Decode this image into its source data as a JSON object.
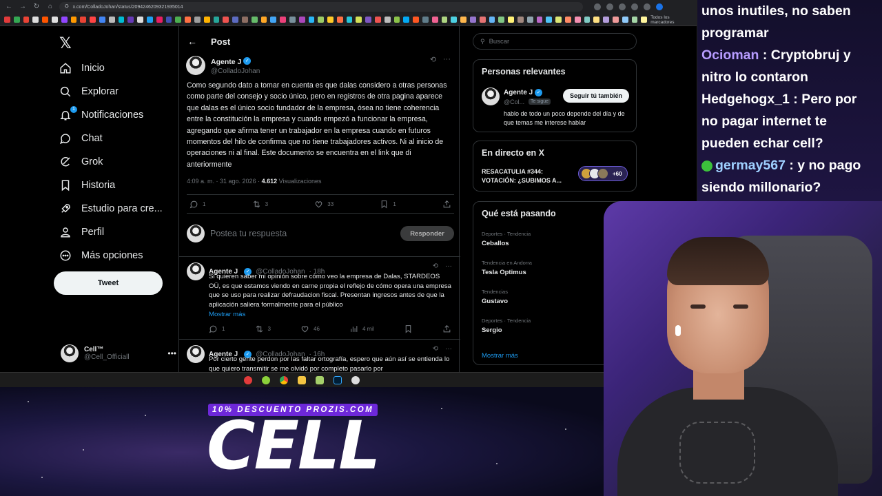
{
  "browser": {
    "url": "x.com/ColladoJohan/status/2094246209321935014",
    "bookmarks_label": "Todos los marcadores"
  },
  "nav": {
    "items": [
      {
        "label": "Inicio",
        "icon": "home-icon"
      },
      {
        "label": "Explorar",
        "icon": "search-icon"
      },
      {
        "label": "Notificaciones",
        "icon": "bell-icon"
      },
      {
        "label": "Chat",
        "icon": "chat-icon"
      },
      {
        "label": "Grok",
        "icon": "grok-icon"
      },
      {
        "label": "Historia",
        "icon": "bookmark-icon"
      },
      {
        "label": "Estudio para cre...",
        "icon": "rocket-icon"
      },
      {
        "label": "Perfil",
        "icon": "person-icon"
      },
      {
        "label": "Más opciones",
        "icon": "more-icon"
      }
    ],
    "notif_count": "1",
    "tweet_button": "Tweet",
    "account_name": "Cell™",
    "account_handle": "@Cell_Officiall"
  },
  "post": {
    "title": "Post",
    "author_name": "Agente J",
    "author_handle": "@ColladoJohan",
    "text": "Como segundo dato a tomar en cuenta es que dalas considero a otras personas como parte del consejo y socio único, pero en registros de otra pagina aparece que dalas es el único socio fundador de la empresa, ósea no tiene coherencia entre la constitución la empresa y cuando empezó a funcionar la empresa, agregando que afirma tener un trabajador en la empresa cuando en futuros momentos del hilo de confirma que no tiene trabajadores activos. Ni al inicio de operaciones ni al final. Este documento se encuentra en el link que di anteriormente",
    "time": "4:09 a. m. · 31 ago. 2026 ·",
    "views_count": "4.612",
    "views_label": "Visualizaciones",
    "replies": "1",
    "reposts": "3",
    "likes": "33",
    "bookmarks": "1",
    "reply_placeholder": "Postea tu respuesta",
    "reply_button": "Responder"
  },
  "replies": [
    {
      "name": "Agente J",
      "handle": "@ColladoJohan",
      "time": "· 18h",
      "text": "Si quieren saber mi opinión sobre cómo veo la empresa de Dalas, STARDEOS OÜ, es que estamos viendo en carne propia el reflejo de cómo opera una empresa que se uso para realizar defraudacion fiscal. Presentan ingresos antes de que la aplicación saliera formalmente para el público",
      "more": "Mostrar más",
      "replies": "1",
      "reposts": "3",
      "likes": "46",
      "views": "4 mil"
    },
    {
      "name": "Agente J",
      "handle": "@ColladoJohan",
      "time": "· 16h",
      "text": "Por cierto gente perdon por las faltar ortografía, espero que aún así se entienda lo que quiero transmitir se me olvidó por completo pasarlo por"
    }
  ],
  "sidebar": {
    "search_placeholder": "Buscar",
    "relevant_title": "Personas relevantes",
    "relevant": {
      "name": "Agente J",
      "handle": "@Col...",
      "badge": "Te sigue",
      "follow_button": "Seguir tú también",
      "bio": "hablo de todo un poco depende del día y de que temas me interese hablar"
    },
    "live_title": "En directo en X",
    "live": {
      "text": "RESACATULIA #344: VOTACIÓN: ¿SUBIMOS A...",
      "count": "+60"
    },
    "trends_title": "Qué está pasando",
    "trends": [
      {
        "category": "Deportes · Tendencia",
        "name": "Ceballos"
      },
      {
        "category": "Tendencia en Andorra",
        "name": "Tesla Optimus"
      },
      {
        "category": "Tendencias",
        "name": "Gustavo"
      },
      {
        "category": "Deportes · Tendencia",
        "name": "Sergio"
      }
    ],
    "show_more": "Mostrar más"
  },
  "chat": {
    "line0": "unos inutiles, no saben programar",
    "messages": [
      {
        "user": "Ocioman",
        "text": " : Cryptobruj y nitro lo contaron"
      },
      {
        "user": "Hedgehogx_1",
        "text": " : Pero por no pagar internet te pueden echar cell?"
      },
      {
        "user": "germay567",
        "text": " : y no pago siendo millonario?"
      }
    ]
  },
  "overlay": {
    "promo": "10% DESCUENTO PROZIS.COM",
    "brand": "CELL"
  },
  "colors": {
    "accent": "#1d9bf0",
    "promo": "#6d28d9"
  }
}
